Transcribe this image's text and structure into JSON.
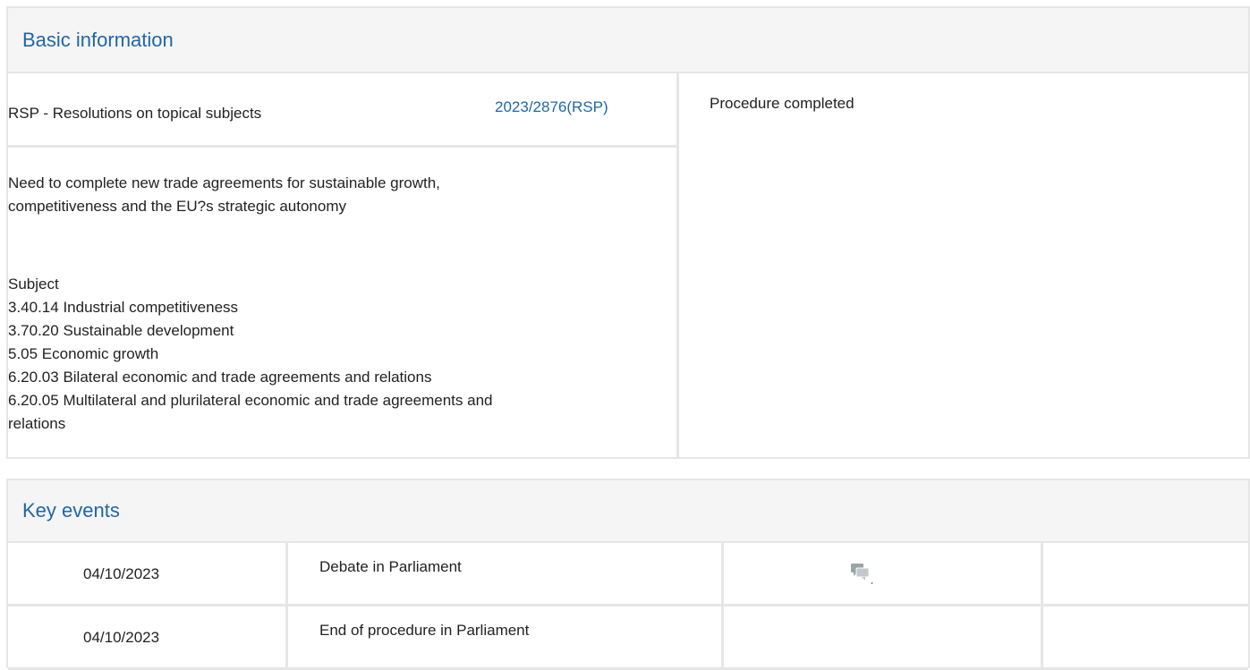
{
  "basic_info": {
    "heading": "Basic information",
    "procedure_type": "RSP - Resolutions on topical subjects",
    "procedure_reference": "2023/2876(RSP)",
    "title_line1": "Need to complete new trade agreements for sustainable growth,",
    "title_line2": "competitiveness and the EU?s strategic autonomy",
    "subject_label": "Subject",
    "subjects": [
      "3.40.14 Industrial competitiveness",
      "3.70.20 Sustainable development",
      "5.05 Economic growth",
      "6.20.03 Bilateral economic and trade agreements and relations",
      "6.20.05 Multilateral and plurilateral economic and trade agreements and",
      "relations"
    ],
    "status": "Procedure completed"
  },
  "key_events": {
    "heading": "Key events",
    "rows": [
      {
        "date": "04/10/2023",
        "event": "Debate in Parliament",
        "icon": "debate-icon"
      },
      {
        "date": "04/10/2023",
        "event": "End of procedure in Parliament"
      }
    ]
  },
  "colors": {
    "accent": "#1f67a8",
    "border": "#e6e6e6",
    "header_bg": "#f5f5f5"
  }
}
